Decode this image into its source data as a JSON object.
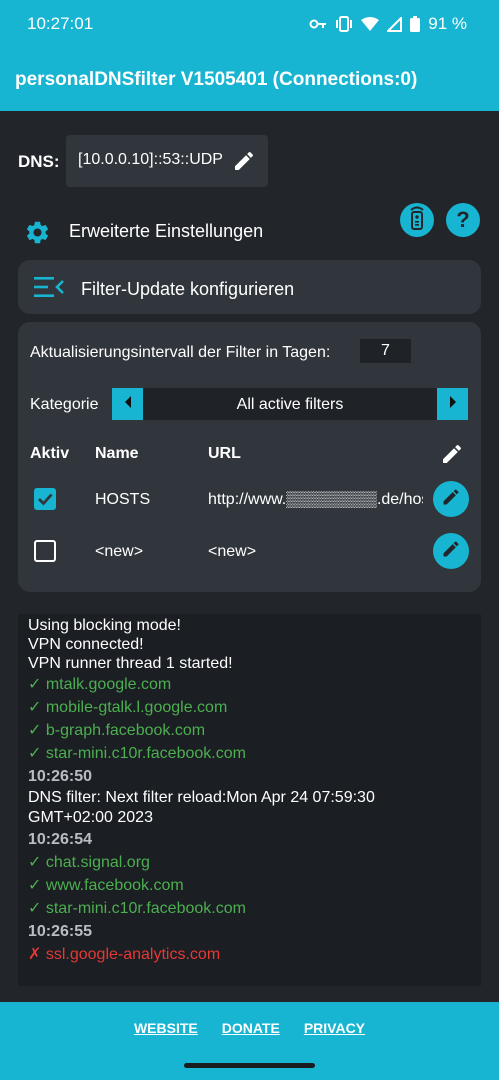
{
  "status_bar": {
    "time": "10:27:01",
    "battery": "91 %",
    "icons": [
      "vpn-key-icon",
      "vibrate-icon",
      "wifi-icon",
      "cell-signal-icon",
      "battery-icon"
    ]
  },
  "app_bar": {
    "title": "personalDNSfilter V1505401 (Connections:0)"
  },
  "dns": {
    "label": "DNS:",
    "value": "[10.0.0.10]::53::UDP"
  },
  "advanced": {
    "label": "Erweiterte Einstellungen"
  },
  "filter_header": {
    "label": "Filter-Update konfigurieren"
  },
  "config": {
    "interval_label": "Aktualisierungsintervall der Filter in Tagen:",
    "interval_value": "7",
    "category_label": "Kategorie",
    "category_value": "All active filters",
    "columns": {
      "active": "Aktiv",
      "name": "Name",
      "url": "URL"
    },
    "rows": [
      {
        "active": true,
        "name": "HOSTS",
        "url": "http://www.▒▒▒▒▒▒▒▒.de/hosts"
      },
      {
        "active": false,
        "name": "<new>",
        "url": "<new>"
      }
    ]
  },
  "log": {
    "lines": [
      {
        "kind": "info",
        "text": "Using blocking mode!"
      },
      {
        "kind": "info",
        "text": "VPN connected!"
      },
      {
        "kind": "info",
        "text": "VPN runner thread 1 started!"
      },
      {
        "kind": "ok",
        "text": "✓  mtalk.google.com"
      },
      {
        "kind": "ok",
        "text": "✓  mobile-gtalk.l.google.com"
      },
      {
        "kind": "ok",
        "text": "✓  b-graph.facebook.com"
      },
      {
        "kind": "ok",
        "text": "✓  star-mini.c10r.facebook.com"
      },
      {
        "kind": "ts",
        "text": "10:26:50"
      },
      {
        "kind": "info",
        "text": "DNS filter: Next filter reload:Mon Apr 24 07:59:30"
      },
      {
        "kind": "info",
        "text": "GMT+02:00 2023"
      },
      {
        "kind": "ts",
        "text": "10:26:54"
      },
      {
        "kind": "ok",
        "text": "✓  chat.signal.org"
      },
      {
        "kind": "ok",
        "text": "✓  www.facebook.com"
      },
      {
        "kind": "ok",
        "text": "✓  star-mini.c10r.facebook.com"
      },
      {
        "kind": "ts",
        "text": "10:26:55"
      },
      {
        "kind": "bad",
        "text": "✗  ssl.google-analytics.com"
      }
    ]
  },
  "footer": {
    "website": "WEBSITE",
    "donate": "DONATE",
    "privacy": "PRIVACY"
  },
  "colors": {
    "accent": "#17b5d2",
    "background": "#22262b",
    "card": "#31363c",
    "ok": "#4caf50",
    "blocked": "#e53935"
  }
}
